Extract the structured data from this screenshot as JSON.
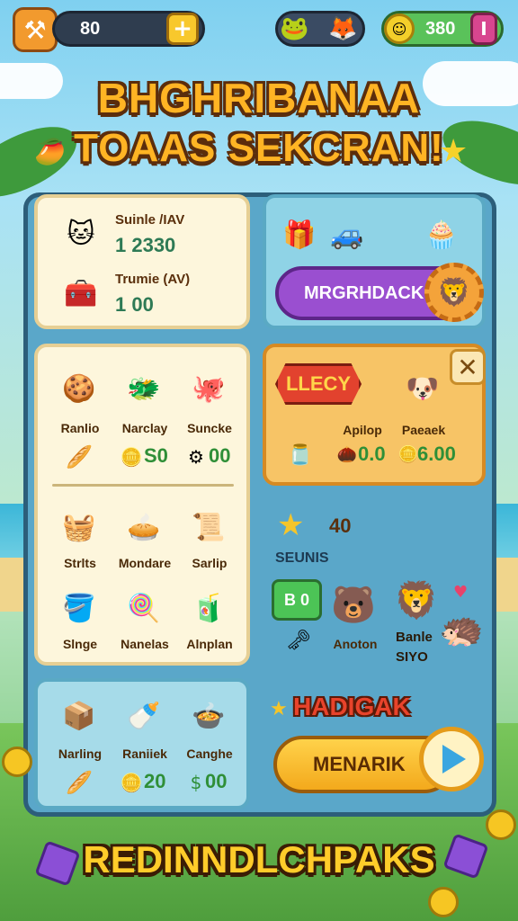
{
  "topbar": {
    "tool_icon": "hammer-wrench-icon",
    "left_counter": "80",
    "left_plus": "+",
    "pets_icons": [
      "frog-pet-icon",
      "fox-pet-icon"
    ],
    "right_counter": "380",
    "right_button": "I"
  },
  "title": {
    "line1": "BHGHRIBANAA",
    "line2": "TOAAS SEKCRAN!"
  },
  "panel_rewards": {
    "row1": {
      "label": "Suinle /IAV",
      "value": "1 2330"
    },
    "row2": {
      "label": "Trumie (AV)",
      "value": "1 00"
    }
  },
  "panel_shop": {
    "button_label": "MRGRHDACK"
  },
  "items_grid": [
    {
      "label": "Ranlio"
    },
    {
      "label": "Narclay",
      "value": "S0"
    },
    {
      "label": "Suncke",
      "value": "00"
    },
    {
      "label": "Strlts"
    },
    {
      "label": "Mondare"
    },
    {
      "label": "Sarlip"
    },
    {
      "label": "Slnge"
    },
    {
      "label": "Nanelas"
    },
    {
      "label": "Alnplan"
    }
  ],
  "offer_card": {
    "sign": "LLECY",
    "close": "✕",
    "items": [
      {
        "label": "Apilop",
        "value": "0.0"
      },
      {
        "label": "Paeaek",
        "value": "6.00"
      }
    ]
  },
  "side_panel": {
    "star_value": "40",
    "section_label": "SEUNIS",
    "green_box": "B 0",
    "pet_label": "Anoton",
    "pet2_label": "Banle",
    "pet2_value": "SIYO",
    "hadigak": "HADIGAK",
    "menarik": "MENARIK"
  },
  "bottom_row": [
    {
      "label": "Narling"
    },
    {
      "label": "Raniiek",
      "value": "20"
    },
    {
      "label": "Canghe",
      "value": "00"
    }
  ],
  "footer_title": "REDINNDLCHPAKS",
  "colors": {
    "title": "#ffb424",
    "board": "#5aa7c9",
    "purple": "#9a4fd0",
    "green_value": "#2f8f37"
  }
}
